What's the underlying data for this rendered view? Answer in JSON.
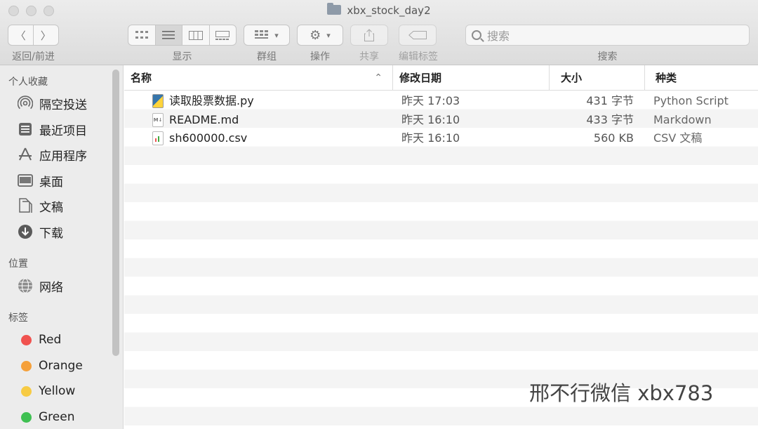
{
  "window": {
    "title": "xbx_stock_day2"
  },
  "toolbar": {
    "back_forward_label": "返回/前进",
    "view_label": "显示",
    "group_label": "群组",
    "action_label": "操作",
    "share_label": "共享",
    "tags_label": "编辑标签",
    "search_label": "搜索",
    "search_placeholder": "搜索"
  },
  "sidebar": {
    "favorites_heading": "个人收藏",
    "favorites": [
      {
        "label": "隔空投送",
        "icon": "airdrop-icon"
      },
      {
        "label": "最近项目",
        "icon": "recents-icon"
      },
      {
        "label": "应用程序",
        "icon": "applications-icon"
      },
      {
        "label": "桌面",
        "icon": "desktop-icon"
      },
      {
        "label": "文稿",
        "icon": "documents-icon"
      },
      {
        "label": "下载",
        "icon": "downloads-icon"
      }
    ],
    "locations_heading": "位置",
    "locations": [
      {
        "label": "网络",
        "icon": "network-icon"
      }
    ],
    "tags_heading": "标签",
    "tags": [
      {
        "label": "Red",
        "color": "#f0524f"
      },
      {
        "label": "Orange",
        "color": "#f5a03a"
      },
      {
        "label": "Yellow",
        "color": "#f7cb44"
      },
      {
        "label": "Green",
        "color": "#3fc052"
      }
    ]
  },
  "list": {
    "columns": {
      "name": "名称",
      "date": "修改日期",
      "size": "大小",
      "kind": "种类"
    },
    "files": [
      {
        "name": "读取股票数据.py",
        "date": "昨天 17:03",
        "size": "431 字节",
        "kind": "Python Script",
        "icon": "python-file-icon"
      },
      {
        "name": "README.md",
        "date": "昨天 16:10",
        "size": "433 字节",
        "kind": "Markdown",
        "icon": "markdown-file-icon"
      },
      {
        "name": "sh600000.csv",
        "date": "昨天 16:10",
        "size": "560 KB",
        "kind": "CSV 文稿",
        "icon": "csv-file-icon"
      }
    ]
  },
  "watermark": "邢不行微信 xbx783"
}
